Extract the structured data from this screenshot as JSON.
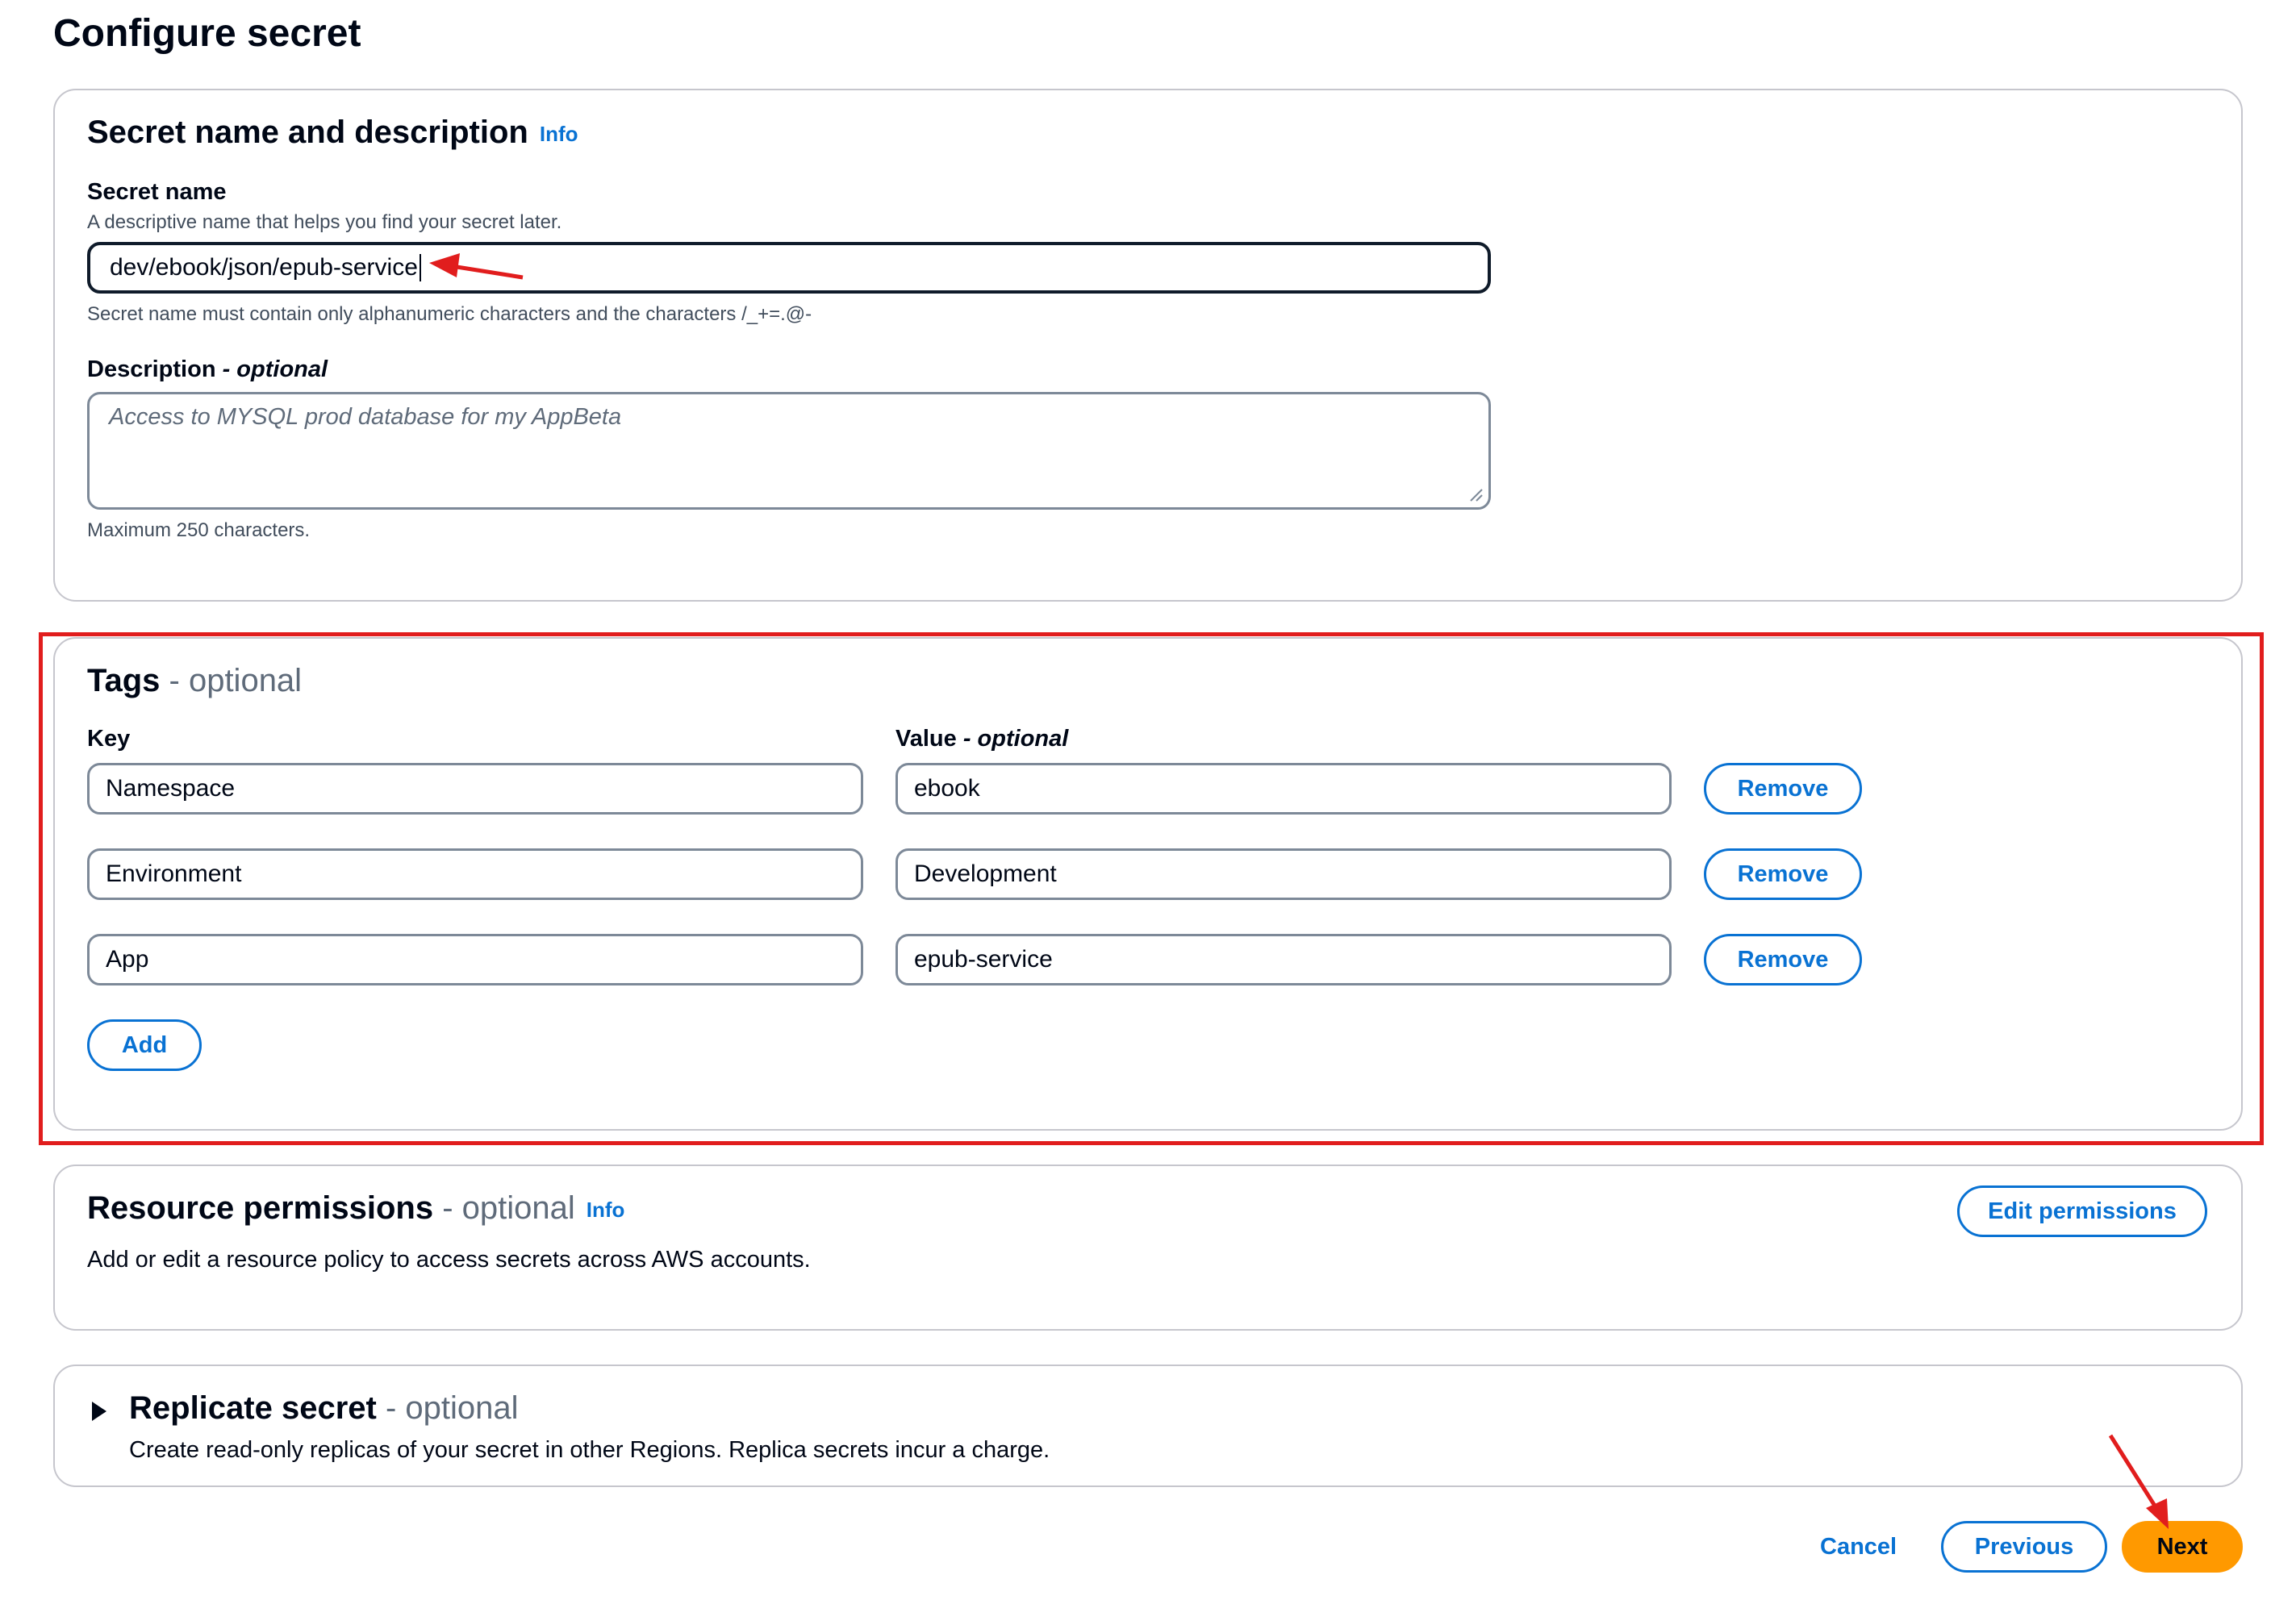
{
  "page": {
    "title": "Configure secret"
  },
  "secret_section": {
    "title": "Secret name and description",
    "info": "Info",
    "name_label": "Secret name",
    "name_help": "A descriptive name that helps you find your secret later.",
    "name_value": "dev/ebook/json/epub-service",
    "name_constraint": "Secret name must contain only alphanumeric characters and the characters /_+=.@-",
    "desc_label": "Description",
    "desc_label_optional": "- optional",
    "desc_placeholder": "Access to MYSQL prod database for my AppBeta",
    "desc_max": "Maximum 250 characters."
  },
  "tags_section": {
    "title": "Tags",
    "optional": "- optional",
    "key_header": "Key",
    "value_header": "Value",
    "value_header_optional": "- optional",
    "remove_label": "Remove",
    "add_label": "Add",
    "rows": [
      {
        "key": "Namespace",
        "value": "ebook"
      },
      {
        "key": "Environment",
        "value": "Development"
      },
      {
        "key": "App",
        "value": "epub-service"
      }
    ]
  },
  "permissions_section": {
    "title": "Resource permissions",
    "optional": "- optional",
    "info": "Info",
    "description": "Add or edit a resource policy to access secrets across AWS accounts.",
    "edit_label": "Edit permissions"
  },
  "replicate_section": {
    "title": "Replicate secret",
    "optional": "- optional",
    "description": "Create read-only replicas of your secret in other Regions. Replica secrets incur a charge."
  },
  "footer": {
    "cancel_label": "Cancel",
    "previous_label": "Previous",
    "next_label": "Next"
  },
  "colors": {
    "link": "#0972d3",
    "primary": "#ff9900",
    "annotation": "#e11d1d"
  }
}
